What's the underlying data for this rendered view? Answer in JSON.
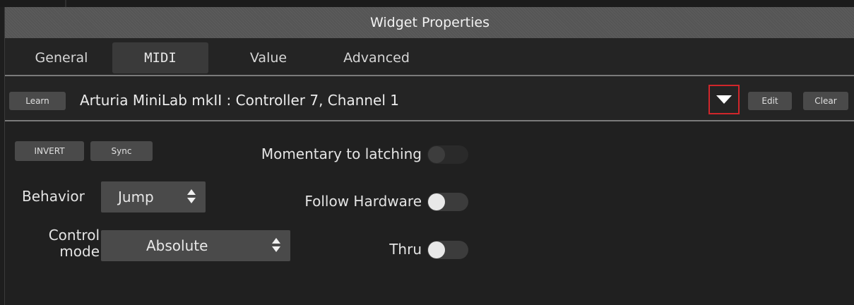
{
  "window": {
    "title": "Widget Properties"
  },
  "tabs": [
    {
      "label": "General",
      "active": false
    },
    {
      "label": "MIDI",
      "active": true
    },
    {
      "label": "Value",
      "active": false
    },
    {
      "label": "Advanced",
      "active": false
    }
  ],
  "mapping": {
    "learn_label": "Learn",
    "text": "Arturia MiniLab mkII : Controller 7, Channel 1",
    "dropdown_icon": "triangle-down-icon",
    "edit_label": "Edit",
    "clear_label": "Clear",
    "highlight_color": "#d0262b"
  },
  "options": {
    "invert_label": "INVERT",
    "sync_label": "Sync",
    "behavior": {
      "label": "Behavior",
      "value": "Jump"
    },
    "control_mode": {
      "label_line1": "Control",
      "label_line2": "mode",
      "value": "Absolute"
    }
  },
  "toggles": {
    "momentary": {
      "label": "Momentary to latching",
      "on": false,
      "enabled": false
    },
    "follow": {
      "label": "Follow Hardware",
      "on": false,
      "enabled": true
    },
    "thru": {
      "label": "Thru",
      "on": false,
      "enabled": true
    }
  },
  "colors": {
    "title_bar": "#555555",
    "background": "#202020",
    "button": "#4a4a4a"
  }
}
